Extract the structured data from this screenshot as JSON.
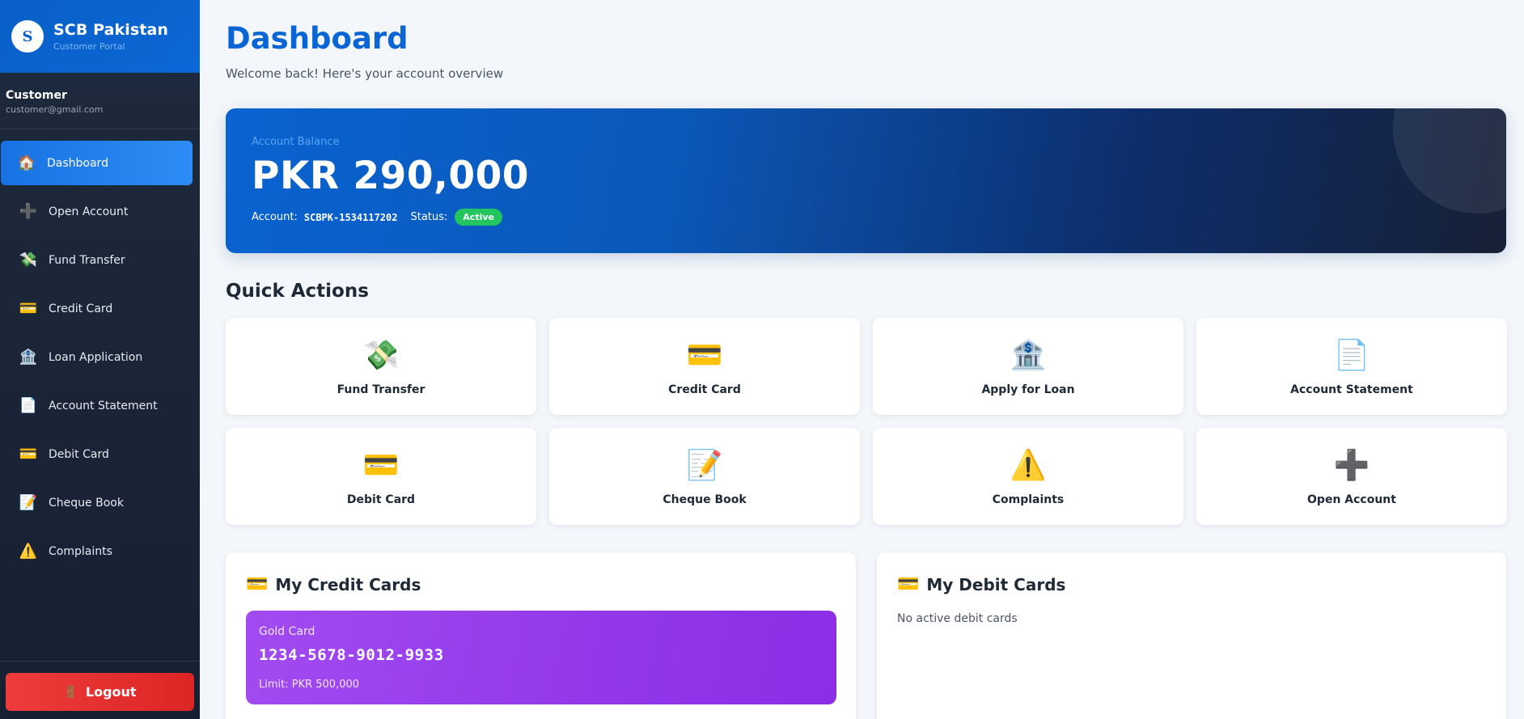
{
  "brand": {
    "title": "SCB Pakistan",
    "subtitle": "Customer Portal",
    "logo_glyph": "S"
  },
  "user": {
    "name": "Customer",
    "email": "customer@gmail.com"
  },
  "nav": [
    {
      "label": "Dashboard",
      "icon": "🏠",
      "icon_name": "home-icon",
      "active": true
    },
    {
      "label": "Open Account",
      "icon": "➕",
      "icon_name": "plus-icon"
    },
    {
      "label": "Fund Transfer",
      "icon": "💸",
      "icon_name": "money-wings-icon"
    },
    {
      "label": "Credit Card",
      "icon": "💳",
      "icon_name": "credit-card-icon"
    },
    {
      "label": "Loan Application",
      "icon": "🏦",
      "icon_name": "bank-icon"
    },
    {
      "label": "Account Statement",
      "icon": "📄",
      "icon_name": "document-icon"
    },
    {
      "label": "Debit Card",
      "icon": "💳",
      "icon_name": "credit-card-icon"
    },
    {
      "label": "Cheque Book",
      "icon": "📝",
      "icon_name": "memo-icon"
    },
    {
      "label": "Complaints",
      "icon": "⚠️",
      "icon_name": "warning-icon"
    }
  ],
  "logout": {
    "label": "Logout",
    "icon": "🚪",
    "icon_name": "door-icon"
  },
  "header": {
    "title": "Dashboard",
    "subtitle": "Welcome back! Here's your account overview"
  },
  "balance": {
    "label": "Account Balance",
    "amount": "PKR 290,000",
    "account_label": "Account:",
    "account_number": "SCBPK-1534117202",
    "status_label": "Status:",
    "status": "Active"
  },
  "quick_actions": {
    "title": "Quick Actions",
    "items": [
      {
        "label": "Fund Transfer",
        "icon": "💸",
        "icon_name": "money-wings-icon"
      },
      {
        "label": "Credit Card",
        "icon": "💳",
        "icon_name": "credit-card-icon"
      },
      {
        "label": "Apply for Loan",
        "icon": "🏦",
        "icon_name": "bank-icon"
      },
      {
        "label": "Account Statement",
        "icon": "📄",
        "icon_name": "document-icon"
      },
      {
        "label": "Debit Card",
        "icon": "💳",
        "icon_name": "credit-card-icon"
      },
      {
        "label": "Cheque Book",
        "icon": "📝",
        "icon_name": "memo-icon"
      },
      {
        "label": "Complaints",
        "icon": "⚠️",
        "icon_name": "warning-icon"
      },
      {
        "label": "Open Account",
        "icon": "➕",
        "icon_name": "plus-icon"
      }
    ]
  },
  "credit_cards": {
    "title": "My Credit Cards",
    "icon": "💳",
    "cards": [
      {
        "type": "Gold Card",
        "number": "1234-5678-9012-9933",
        "limit": "Limit: PKR 500,000"
      }
    ]
  },
  "debit_cards": {
    "title": "My Debit Cards",
    "icon": "💳",
    "empty_text": "No active debit cards"
  },
  "colors": {
    "primary": "#0a66d4",
    "sidebar_bg": "#1e2a3d",
    "active_nav": "#1773e2",
    "status_active": "#22c55e",
    "logout": "#ef3b3b",
    "credit_card_bg": "#9238ea"
  }
}
